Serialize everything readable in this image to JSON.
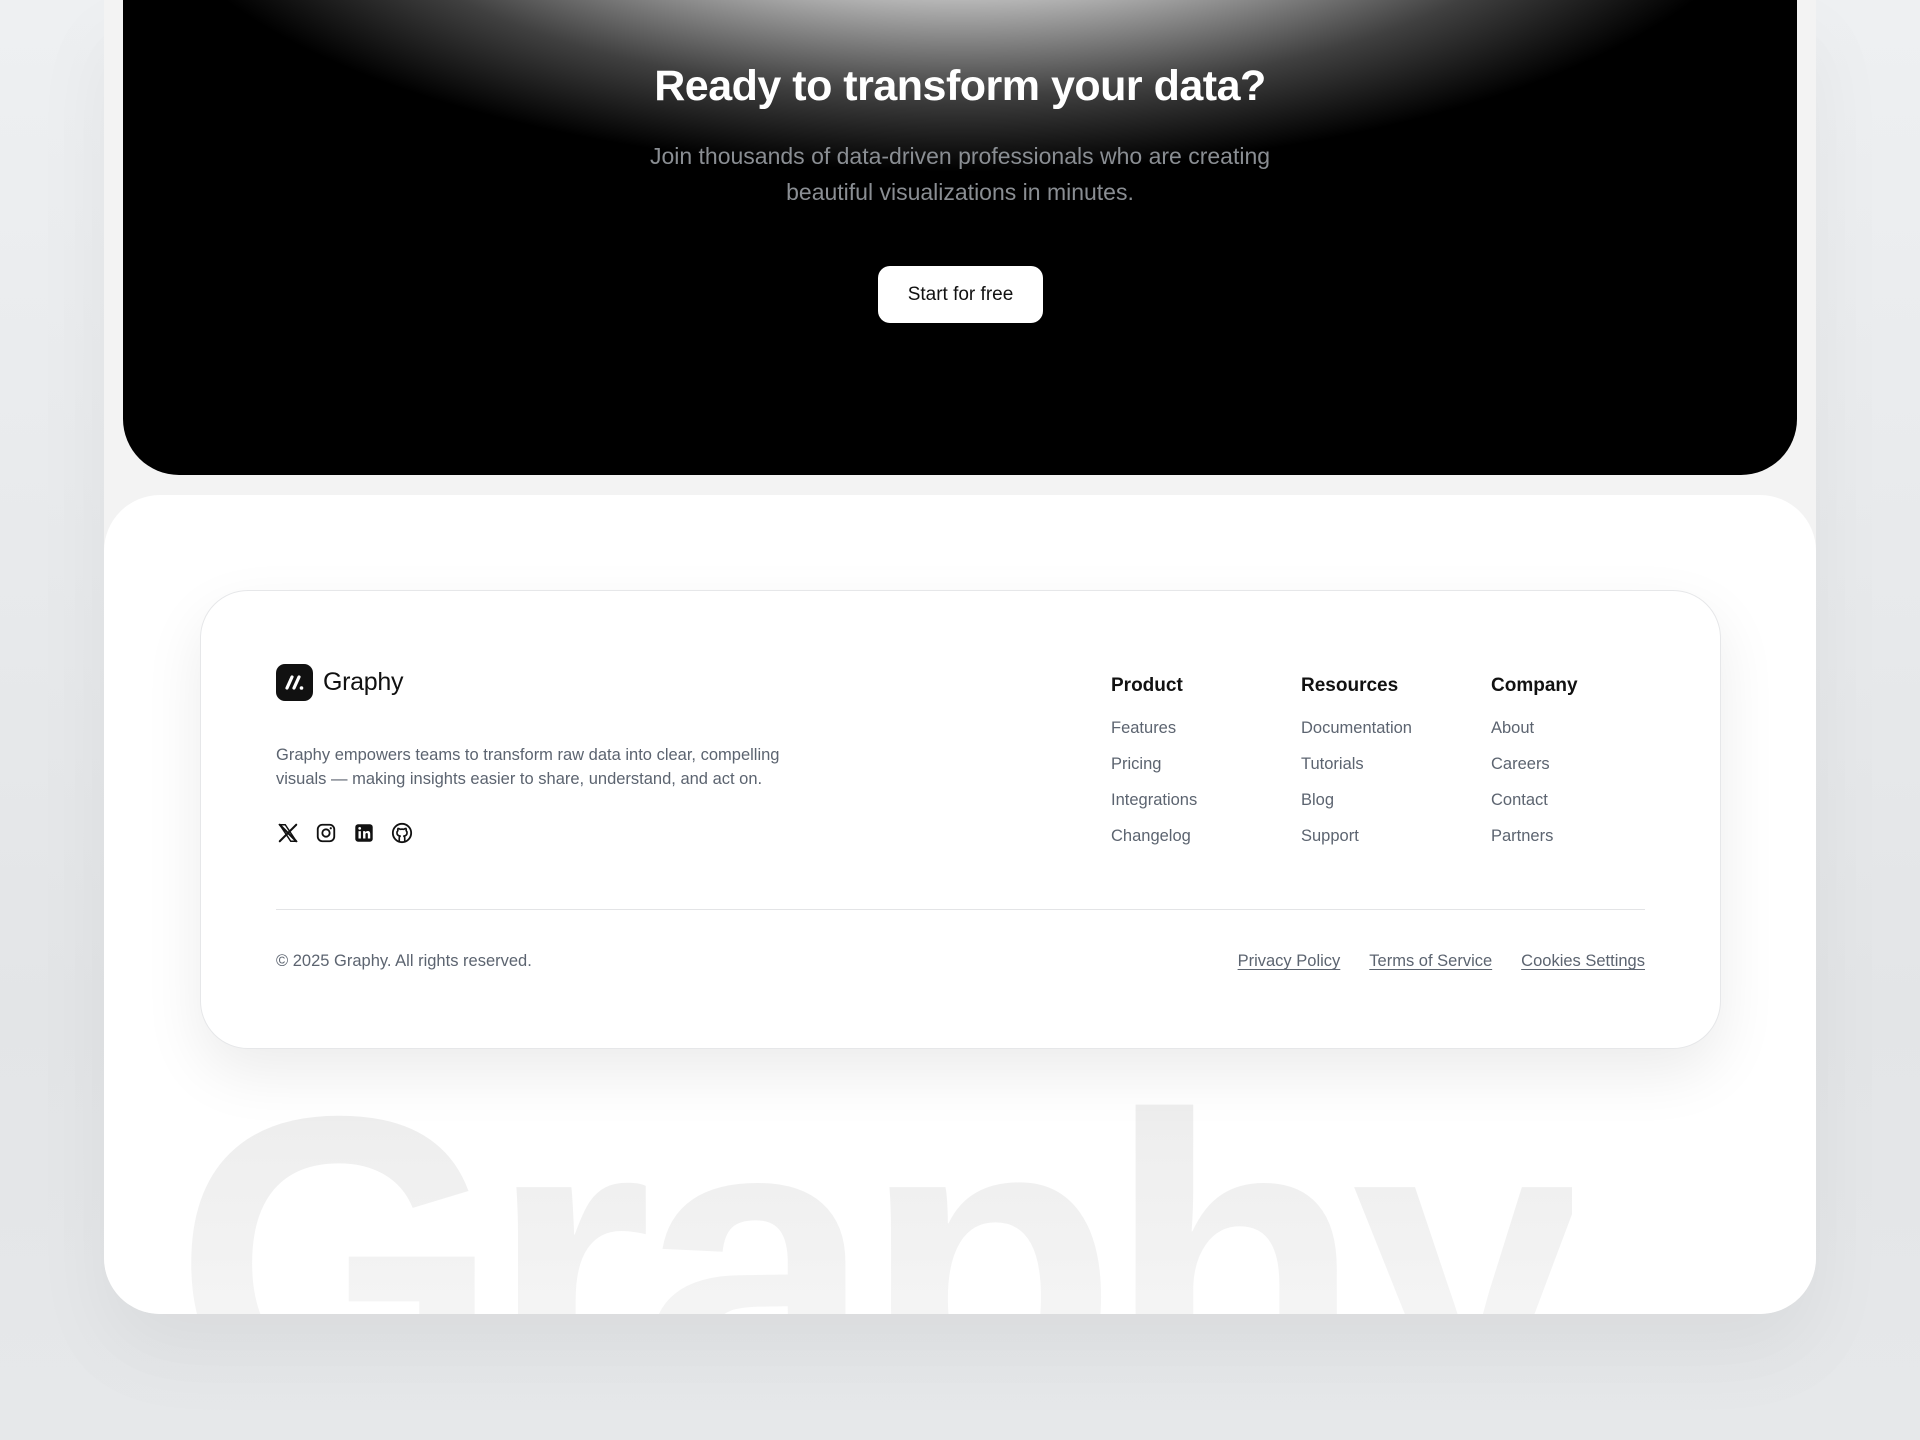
{
  "cta": {
    "title": "Ready to transform your data?",
    "subtitle": "Join thousands of data-driven professionals who are creating beautiful visualizations in minutes.",
    "button_label": "Start for free"
  },
  "footer": {
    "brand_name": "Graphy",
    "description": "Graphy empowers teams to transform raw data into clear, compelling visuals — making insights easier to share, understand, and act on.",
    "socials": [
      "x-icon",
      "instagram-icon",
      "linkedin-icon",
      "github-icon"
    ],
    "columns": [
      {
        "title": "Product",
        "links": [
          "Features",
          "Pricing",
          "Integrations",
          "Changelog"
        ]
      },
      {
        "title": "Resources",
        "links": [
          "Documentation",
          "Tutorials",
          "Blog",
          "Support"
        ]
      },
      {
        "title": "Company",
        "links": [
          "About",
          "Careers",
          "Contact",
          "Partners"
        ]
      }
    ],
    "copyright": "© 2025 Graphy. All rights reserved.",
    "legal_links": [
      "Privacy Policy",
      "Terms of Service",
      "Cookies Settings"
    ],
    "watermark": "Graphy"
  },
  "colors": {
    "cta_background": "#000000",
    "text_muted": "#5c6470",
    "brand_dark": "#111111"
  }
}
